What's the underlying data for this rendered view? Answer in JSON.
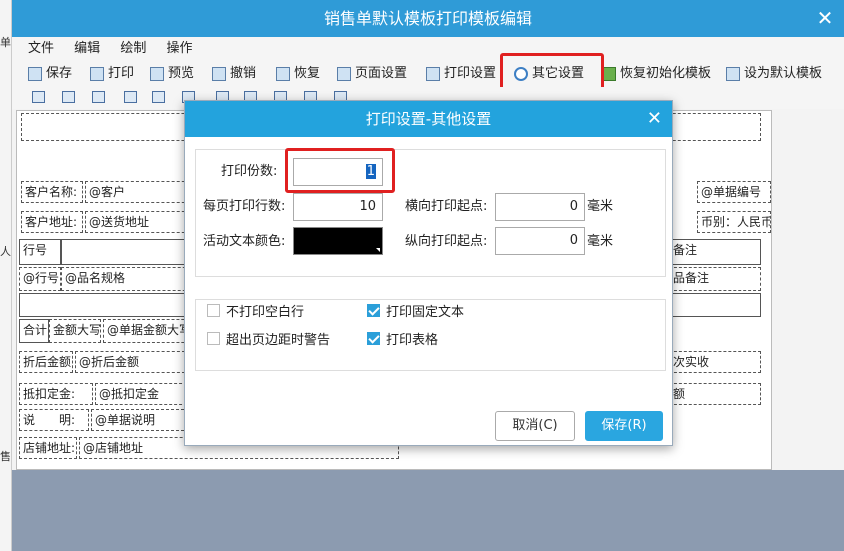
{
  "window": {
    "title": "销售单默认模板打印模板编辑",
    "close": "✕"
  },
  "left_strip": {
    "items": [
      "单",
      "人",
      "售"
    ]
  },
  "menu": [
    "文件",
    "编辑",
    "绘制",
    "操作"
  ],
  "toolbar": [
    "保存",
    "打印",
    "预览",
    "撤销",
    "恢复",
    "页面设置",
    "打印设置",
    "其它设置",
    "恢复初始化模板",
    "设为默认模板"
  ],
  "template": {
    "customer_name_label": "客户名称:",
    "customer_name": "@客户",
    "customer_addr_label": "客户地址:",
    "customer_addr": "@送货地址",
    "bill_no": "@单据编号",
    "currency": "币别：人民币",
    "col_no": "行号",
    "col_note": "备注",
    "row_no": "@行号",
    "row_item": "@品名规格",
    "row_note": "品备注",
    "total_label": "合计",
    "amount_caps_label": "金额大写",
    "amount_caps": "@单据金额大写",
    "discount_label": "折后金额",
    "discount": "@折后金额",
    "paid": "次实收",
    "deposit_label": "抵扣定金:",
    "deposit": "@抵扣定金",
    "amount_tail": "额",
    "remark_label": "说　　明:",
    "remark": "@单据说明",
    "shop_addr_label": "店铺地址:",
    "shop_addr": "@店铺地址"
  },
  "dialog": {
    "title": "打印设置-其他设置",
    "close": "✕",
    "copies_label": "打印份数:",
    "copies": "1",
    "rows_label": "每页打印行数:",
    "rows": "10",
    "hstart_label": "横向打印起点:",
    "hstart": "0",
    "hunit": "毫米",
    "color_label": "活动文本颜色:",
    "vstart_label": "纵向打印起点:",
    "vstart": "0",
    "vunit": "毫米",
    "opt_blank": "不打印空白行",
    "opt_fixed": "打印固定文本",
    "opt_warn": "超出页边距时警告",
    "opt_table": "打印表格",
    "cancel": "取消(C)",
    "save": "保存(R)"
  }
}
